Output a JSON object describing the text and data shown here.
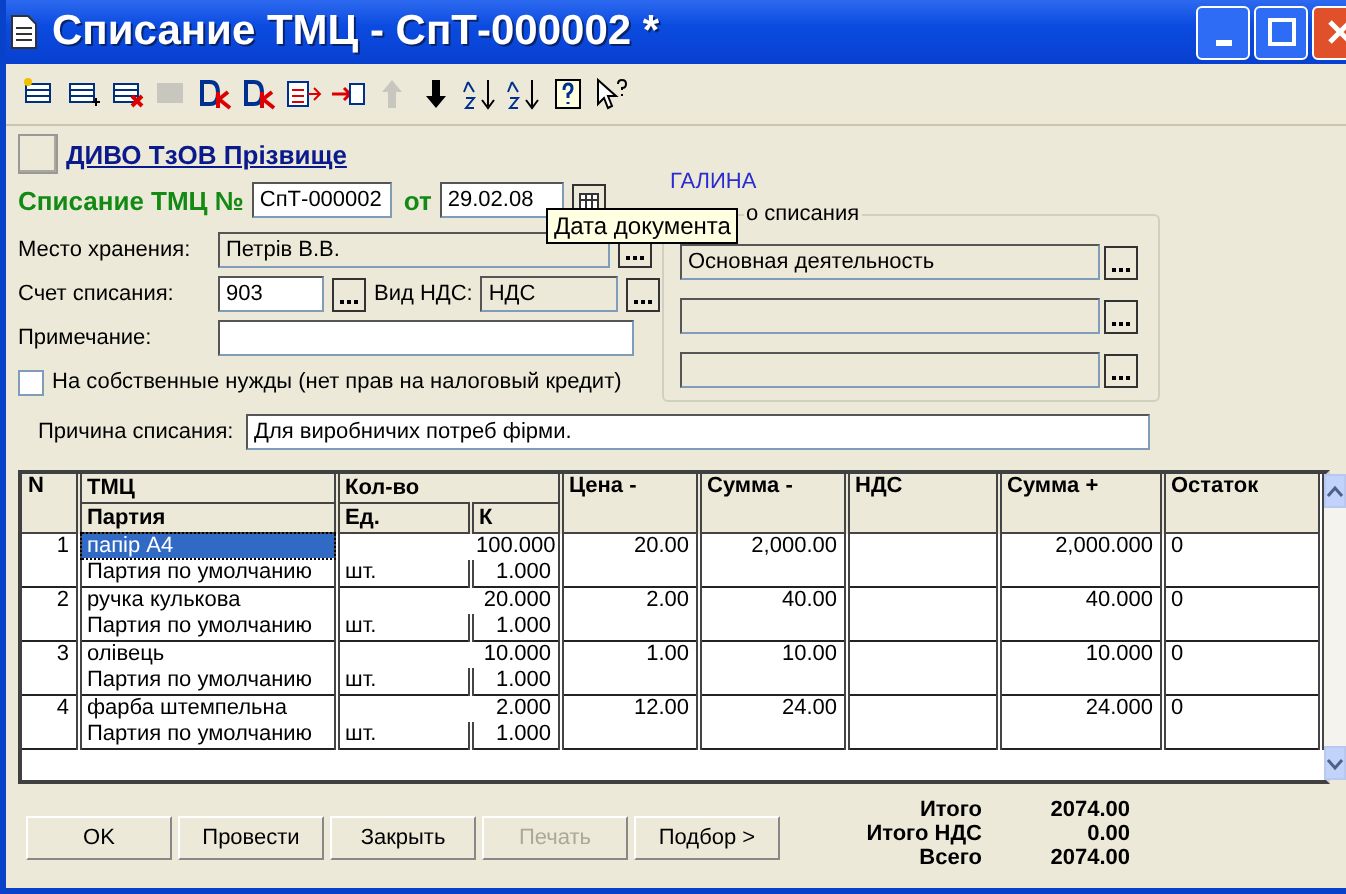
{
  "window": {
    "title": "Списание ТМЦ - СпТ-000002 *"
  },
  "toolbar": [
    {
      "kind": "table-star",
      "disabled": false
    },
    {
      "kind": "table-plus",
      "disabled": false
    },
    {
      "kind": "table-cross",
      "disabled": false
    },
    {
      "kind": "table-copy",
      "disabled": true
    },
    {
      "kind": "dk-cross",
      "disabled": false
    },
    {
      "kind": "dk",
      "disabled": false
    },
    {
      "kind": "list-arrow",
      "disabled": false
    },
    {
      "kind": "arrow-in",
      "disabled": false
    },
    {
      "kind": "up",
      "disabled": true
    },
    {
      "kind": "down",
      "disabled": false
    },
    {
      "kind": "sort-az",
      "disabled": false
    },
    {
      "kind": "sort-za",
      "disabled": false
    },
    {
      "kind": "help",
      "disabled": false
    },
    {
      "kind": "pointer-help",
      "disabled": false
    }
  ],
  "company": "ДИВО  ТзОВ  Прізвище",
  "doc": {
    "label": "Списание ТМЦ №",
    "number": "СпТ-000002",
    "date_label": "от",
    "date": "29.02.08"
  },
  "user": "ГАЛИНА",
  "tooltip": "Дата документа",
  "fields": [
    {
      "label": "Место хранения:",
      "value": "Петрів В.В.",
      "readonly": true
    },
    {
      "label": "Счет списания:",
      "value": "903",
      "readonly": false,
      "extra_label": "Вид НДС:",
      "extra_value": "НДС"
    },
    {
      "label": "Примечание:",
      "readonly": false
    }
  ],
  "own_needs": {
    "label": "На собственные нужды (нет прав на налоговый кредит)",
    "checked": false
  },
  "subconto": {
    "legend": "о списания",
    "rows": [
      {
        "value": "Основная деятельность",
        "readonly": true
      },
      {
        "readonly": true
      },
      {
        "readonly": true
      }
    ]
  },
  "reason": {
    "label": "Причина списания:",
    "value": "Для виробничих потреб фірми."
  },
  "table": {
    "columns": [
      "N",
      "ТМЦ",
      "Кол-во",
      "Цена -",
      "Сумма -",
      "НДС",
      "Сумма +",
      "Остаток"
    ],
    "subcolumns": [
      "Партия",
      "Ед.",
      "К"
    ],
    "rows": [
      {
        "n": "1",
        "item": "папір А4",
        "batch": "Партия по умолчанию",
        "unit": "шт.",
        "qty": "100.000",
        "k": "1.000",
        "price": "20.00",
        "sum_minus": "2,000.00",
        "sum_plus": "2,000.000",
        "remainder": "0",
        "selected": true
      },
      {
        "n": "2",
        "item": "ручка кулькова",
        "batch": "Партия по умолчанию",
        "unit": "шт.",
        "qty": "20.000",
        "k": "1.000",
        "price": "2.00",
        "sum_minus": "40.00",
        "sum_plus": "40.000",
        "remainder": "0",
        "selected": false
      },
      {
        "n": "3",
        "item": "олівець",
        "batch": "Партия по умолчанию",
        "unit": "шт.",
        "qty": "10.000",
        "k": "1.000",
        "price": "1.00",
        "sum_minus": "10.00",
        "sum_plus": "10.000",
        "remainder": "0",
        "selected": false
      },
      {
        "n": "4",
        "item": "фарба штемпельна",
        "batch": "Партия по умолчанию",
        "unit": "шт.",
        "qty": "2.000",
        "k": "1.000",
        "price": "12.00",
        "sum_minus": "24.00",
        "sum_plus": "24.000",
        "remainder": "0",
        "selected": false
      }
    ]
  },
  "buttons": [
    {
      "label": "OK",
      "disabled": false
    },
    {
      "label": "Провести",
      "disabled": false
    },
    {
      "label": "Закрыть",
      "disabled": false
    },
    {
      "label": "Печать",
      "disabled": true
    },
    {
      "label": "Подбор >",
      "disabled": false
    }
  ],
  "totals": [
    {
      "label": "Итого",
      "value": "2074.00"
    },
    {
      "label": "Итого НДС",
      "value": "0.00"
    },
    {
      "label": "Всего",
      "value": "2074.00"
    }
  ]
}
